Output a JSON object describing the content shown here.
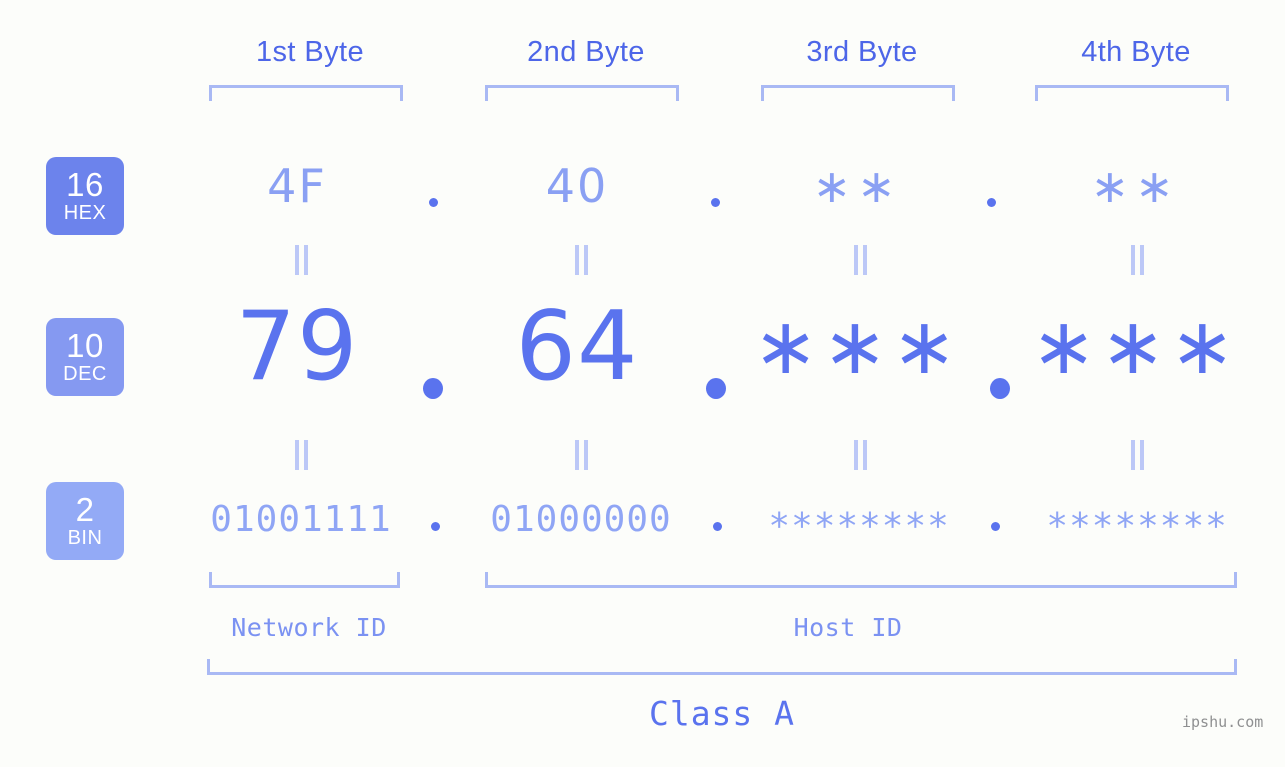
{
  "colors": {
    "background": "#fcfdfa",
    "header_text": "#4d66e8",
    "bracket": "#a9b9f4",
    "hex_value": "#8aa0f3",
    "dec_value": "#5a73ee",
    "bin_value": "#8fa5f5",
    "eq_mark": "#bcc8f7",
    "badge_hex": "#6c83ec",
    "badge_dec": "#8599f1",
    "badge_bin": "#93aaf6",
    "watermark": "#8f9091"
  },
  "byte_headers": [
    {
      "label": "1st Byte"
    },
    {
      "label": "2nd Byte"
    },
    {
      "label": "3rd Byte"
    },
    {
      "label": "4th Byte"
    }
  ],
  "bases": [
    {
      "number": "16",
      "name": "HEX"
    },
    {
      "number": "10",
      "name": "DEC"
    },
    {
      "number": "2",
      "name": "BIN"
    }
  ],
  "rows": {
    "hex": {
      "base_number": "16",
      "base_name": "HEX",
      "values": [
        "4F",
        "40",
        "∗∗",
        "∗∗"
      ]
    },
    "dec": {
      "base_number": "10",
      "base_name": "DEC",
      "values": [
        "79",
        "64",
        "∗∗∗",
        "∗∗∗"
      ]
    },
    "bin": {
      "base_number": "2",
      "base_name": "BIN",
      "values": [
        "01001111",
        "01000000",
        "∗∗∗∗∗∗∗∗",
        "∗∗∗∗∗∗∗∗"
      ]
    }
  },
  "separators": {
    "dot": ".",
    "equality": "||"
  },
  "footer": {
    "network_id": "Network ID",
    "host_id": "Host ID",
    "class": "Class A",
    "watermark": "ipshu.com"
  }
}
